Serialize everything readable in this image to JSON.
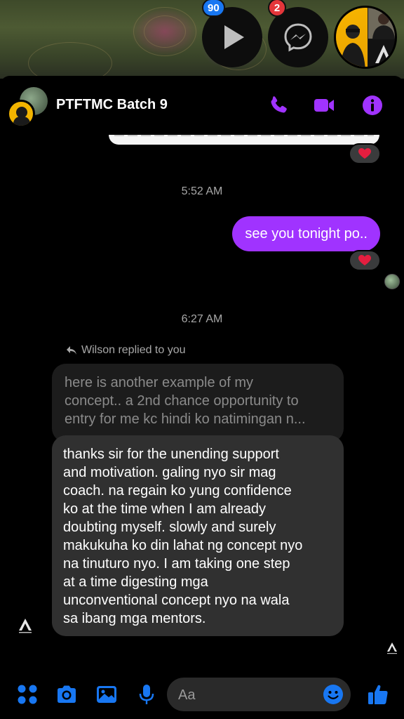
{
  "chat_heads": {
    "play_badge": "90",
    "messenger_badge": "2"
  },
  "header": {
    "title": "PTFTMC Batch 9"
  },
  "messages": {
    "timestamp_1": "5:52 AM",
    "outgoing_text": "see you tonight po..",
    "timestamp_2": "6:27 AM",
    "reply_label": "Wilson replied to you",
    "quoted_lines": [
      "here is another example of my",
      "concept.. a 2nd chance opportunity to",
      "entry for me kc hindi ko natimingan n..."
    ],
    "incoming_lines": [
      "thanks sir for the unending support",
      "and motivation. galing nyo sir mag",
      "coach. na regain ko yung confidence",
      "ko at the time when I am already",
      "doubting myself. slowly and surely",
      "makukuha ko din lahat ng concept nyo",
      "na tinuturo nyo. I am taking one step",
      "at a time digesting mga",
      "unconventional concept nyo na wala",
      "sa ibang mga mentors."
    ]
  },
  "composer": {
    "placeholder": "Aa"
  },
  "colors": {
    "accent": "#a033ff",
    "composer_blue": "#1877f2",
    "heart": "#e41e3f"
  }
}
